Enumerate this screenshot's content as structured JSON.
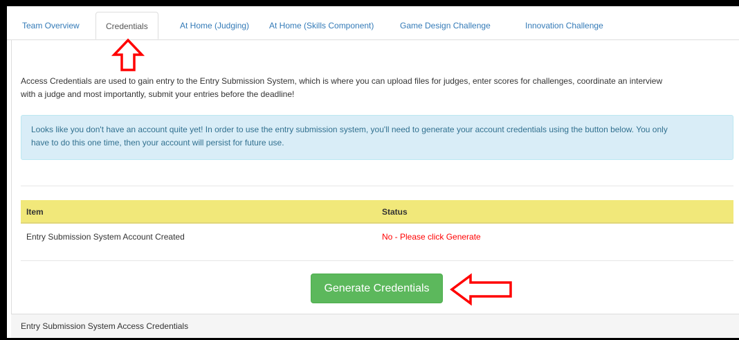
{
  "tabs": [
    {
      "label": "Team Overview"
    },
    {
      "label": "Credentials"
    },
    {
      "label": "At Home (Judging)"
    },
    {
      "label": "At Home (Skills Component)"
    },
    {
      "label": "Game Design Challenge"
    },
    {
      "label": "Innovation Challenge"
    }
  ],
  "active_tab": "Credentials",
  "intro": {
    "line1": "Access Credentials are used to gain entry to the Entry Submission System, which is where you can upload files for judges, enter scores for challenges, coordinate an interview",
    "line2": "with a judge and most importantly, submit your entries before the deadline!"
  },
  "alert": {
    "line1": "Looks like you don't have an account quite yet! In order to use the entry submission system, you'll need to generate your account credentials using the button below. You only",
    "line2": "have to do this one time, then your account will persist for future use."
  },
  "table": {
    "headers": {
      "item": "Item",
      "status": "Status"
    },
    "rows": [
      {
        "item": "Entry Submission System Account Created",
        "status": "No - Please click Generate"
      }
    ]
  },
  "generate_button": {
    "label": "Generate Credentials"
  },
  "footer": {
    "title": "Entry Submission System Access Credentials"
  },
  "colors": {
    "annotation_arrow": "#ff0000",
    "button": "#5cb85c",
    "table_header": "#f1e87a",
    "alert_background": "#d9edf7",
    "link": "#337ab7"
  },
  "icons": [
    "up-arrow-annotation-icon",
    "left-arrow-annotation-icon"
  ]
}
